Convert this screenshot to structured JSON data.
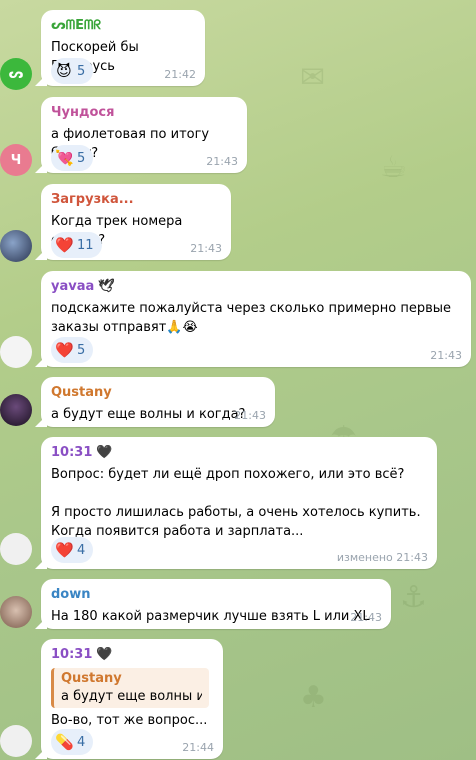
{
  "messages": [
    {
      "sender": "ᔕᗰEᗰᖇ",
      "sender_color": "#3aa53a",
      "avatar_letter": "ᔕ",
      "avatar_color": "#3cb83c",
      "text": "Поскорей бы Беларусь",
      "reaction_emoji": "😈",
      "reaction_count": "5",
      "time": "21:42"
    },
    {
      "sender": "Чундося",
      "sender_color": "#c0529a",
      "avatar_letter": "Ч",
      "avatar_color": "#e97b90",
      "text": "а фиолетовая по итогу будет?",
      "reaction_emoji": "💘",
      "reaction_count": "5",
      "time": "21:43"
    },
    {
      "sender": "Загрузка...",
      "sender_color": "#d0553b",
      "avatar_letter": "",
      "avatar_color": "#4a5a7a",
      "text": "Когда трек номера скинут?",
      "reaction_emoji": "❤️",
      "reaction_count": "11",
      "time": "21:43"
    },
    {
      "sender": "yavaa",
      "sender_color": "#8a4fc4",
      "sender_badge": "🕊",
      "avatar_letter": "",
      "avatar_color": "#f4f4f4",
      "text": "подскажите пожалуйста через сколько примерно первые заказы отправят🙏😭",
      "reaction_emoji": "❤️",
      "reaction_count": "5",
      "time": "21:43"
    },
    {
      "sender": "Qustany",
      "sender_color": "#d0782f",
      "avatar_letter": "",
      "avatar_color": "#3a2a3a",
      "text": "а будут еще волны и когда?",
      "time": "21:43"
    },
    {
      "sender": "10:31",
      "sender_color": "#8a4fc4",
      "sender_badge": "🖤",
      "avatar_letter": "",
      "avatar_color": "#f0f0f0",
      "text_lines": [
        "Вопрос: будет ли ещё дроп похожего, или это всё?",
        "",
        "Я просто лишилась работы, а очень хотелось купить. Когда появится работа и зарплата..."
      ],
      "reaction_emoji": "❤️",
      "reaction_count": "4",
      "time": "изменено 21:43"
    },
    {
      "sender": "down",
      "sender_color": "#3a85c4",
      "avatar_letter": "",
      "avatar_color": "#b89a8a",
      "text": "На 180 какой размерчик лучше взять L или XL",
      "time": "21:43"
    },
    {
      "sender": "10:31",
      "sender_color": "#8a4fc4",
      "sender_badge": "🖤",
      "avatar_letter": "",
      "avatar_color": "#f0f0f0",
      "reply_name": "Qustany",
      "reply_text": "а будут еще волны и ...",
      "text": "Во-во, тот же вопрос...",
      "reaction_emoji": "💊",
      "reaction_count": "4",
      "time": "21:44"
    }
  ]
}
